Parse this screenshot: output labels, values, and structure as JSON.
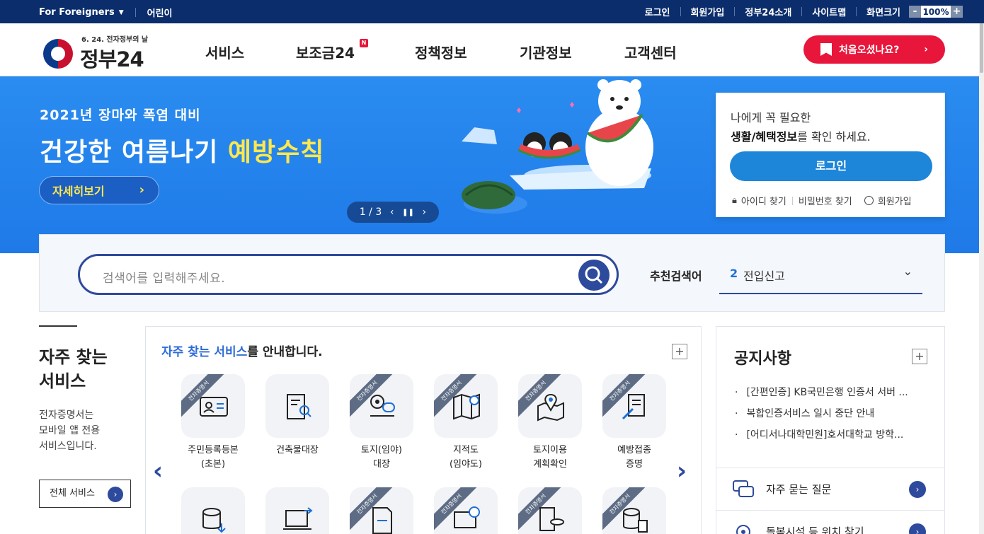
{
  "topbar": {
    "foreigners": "For Foreigners",
    "kids": "어린이",
    "links": [
      "로그인",
      "회원가입",
      "정부24소개",
      "사이트맵"
    ],
    "zoom_label": "화면크기",
    "zoom_minus": "-",
    "zoom_value": "100%",
    "zoom_plus": "+"
  },
  "header": {
    "slogan": "6. 24. 전자정부의 날",
    "logo_text": "정부24",
    "nav": [
      "서비스",
      "보조금24",
      "정책정보",
      "기관정보",
      "고객센터"
    ],
    "new_badge": "N",
    "first_visit": "처음오셨나요?"
  },
  "banner": {
    "subtitle": "2021년 장마와 폭염 대비",
    "title_main": "건강한 여름나기 ",
    "title_highlight": "예방수칙",
    "more": "자세히보기",
    "pager": "1 / 3"
  },
  "login": {
    "line1": "나에게 꼭 필요한",
    "line2_bold": "생활/혜택정보",
    "line2_rest": "를 확인 하세요.",
    "button": "로그인",
    "find_id": "아이디 찾기",
    "find_pw": "비밀번호 찾기",
    "join": "회원가입"
  },
  "search": {
    "placeholder": "검색어를 입력해주세요.",
    "recommend_label": "추천검색어",
    "recommend_num": "2",
    "recommend_keyword": "전입신고"
  },
  "frequent": {
    "title1": "자주 찾는",
    "title2": "서비스",
    "desc1": "전자증명서는",
    "desc2": "모바일 앱 전용",
    "desc3": "서비스입니다.",
    "all_services": "전체 서비스"
  },
  "services": {
    "title_highlight": "자주 찾는 서비스",
    "title_rest": "를 안내합니다.",
    "ribbon": "전자증명서",
    "items": [
      {
        "line1": "주민등록등본",
        "line2": "(초본)"
      },
      {
        "line1": "건축물대장",
        "line2": ""
      },
      {
        "line1": "토지(임야)",
        "line2": "대장"
      },
      {
        "line1": "지적도",
        "line2": "(임야도)"
      },
      {
        "line1": "토지이용",
        "line2": "계획확인"
      },
      {
        "line1": "예방접종",
        "line2": "증명"
      }
    ]
  },
  "notice": {
    "title": "공지사항",
    "items": [
      "[간편인증] KB국민은행 인증서 서버 ...",
      "복합인증서비스 일시 중단 안내",
      "[어디서나대학민원]호서대학교 방학..."
    ],
    "faq": "자주 묻는 질문",
    "facility": "돌봄시설 등 위치 찾기"
  },
  "colors": {
    "topbar": "#0b2d6b",
    "accent_red": "#e8163a",
    "banner_blue": "#1f7ae8",
    "primary": "#2d4a9c"
  }
}
